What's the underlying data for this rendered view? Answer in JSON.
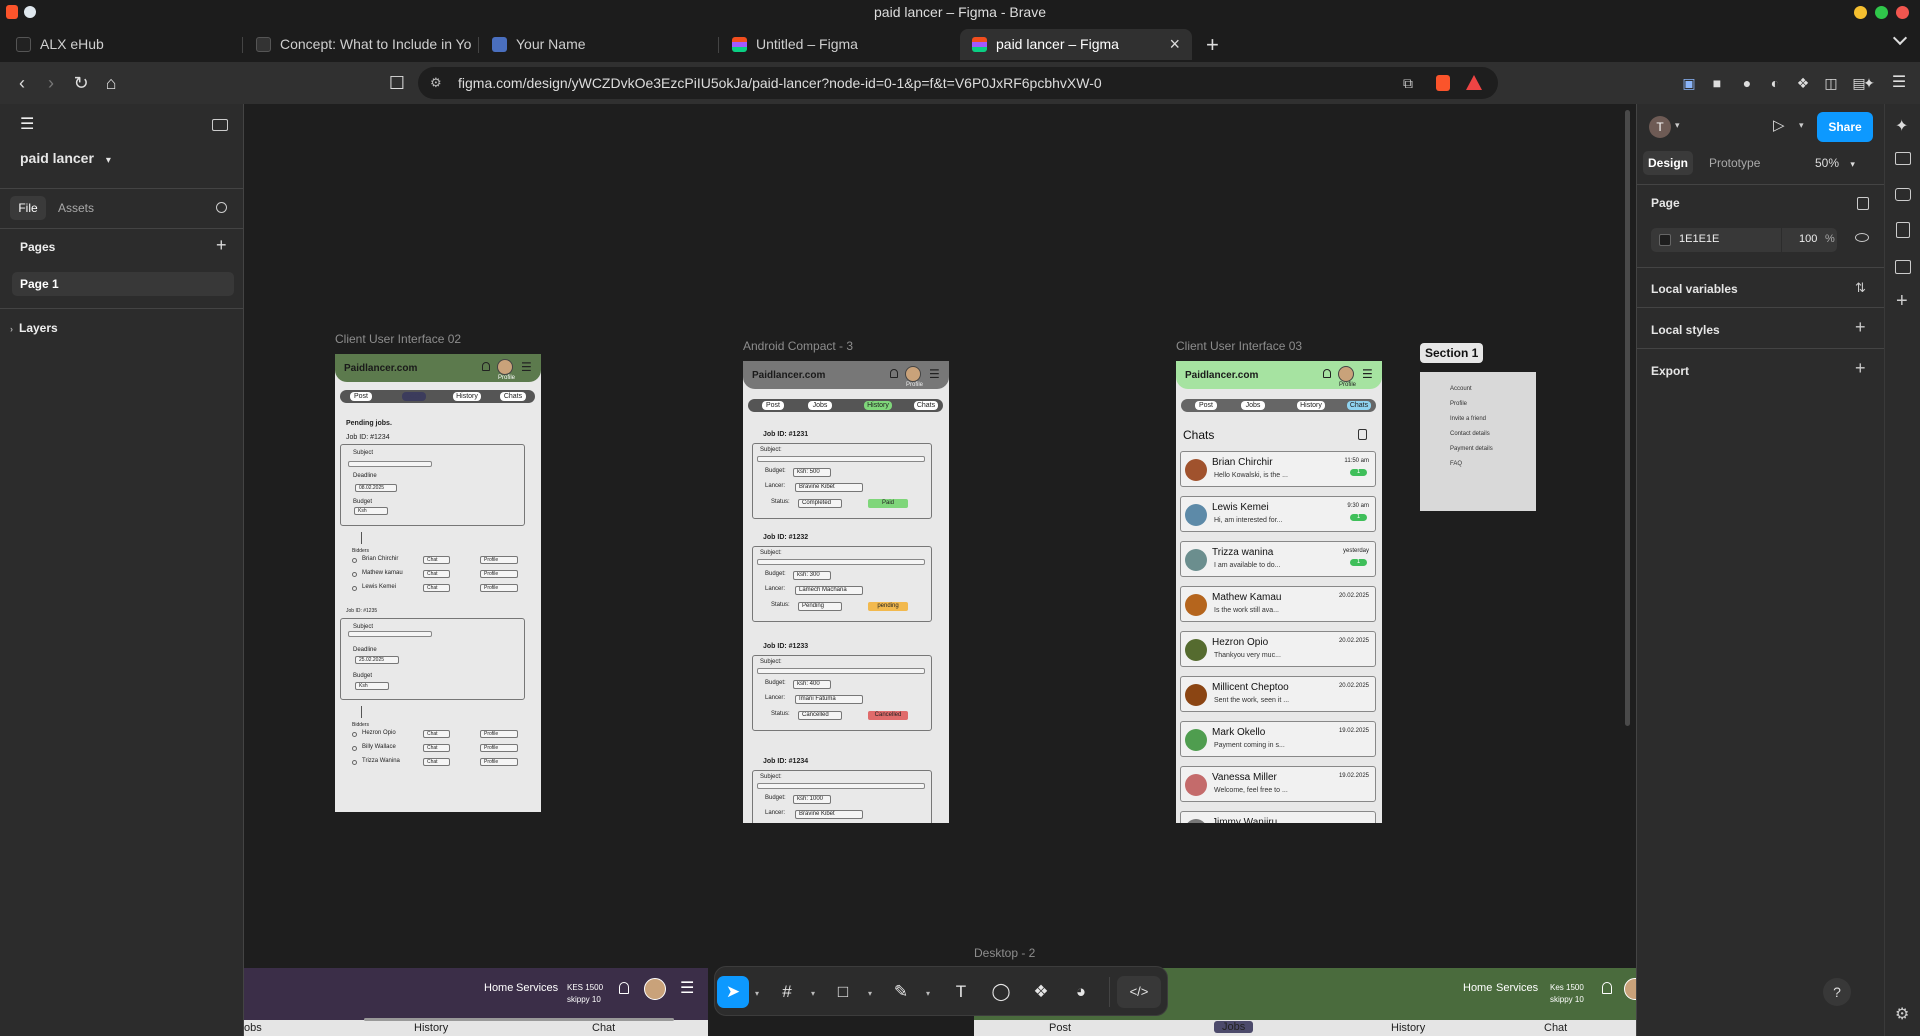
{
  "window": {
    "title": "paid lancer – Figma - Brave"
  },
  "tabs": [
    {
      "label": "ALX eHub",
      "active": false,
      "icon": "alx-icon"
    },
    {
      "label": "Concept: What to Include in Yo",
      "active": false,
      "icon": "notion-icon"
    },
    {
      "label": "Your Name",
      "active": false,
      "icon": "doc-icon"
    },
    {
      "label": "Untitled – Figma",
      "active": false,
      "icon": "figma-icon"
    },
    {
      "label": "paid lancer – Figma",
      "active": true,
      "icon": "figma-icon"
    }
  ],
  "tab_close": "×",
  "new_tab": "+",
  "address": {
    "url": "figma.com/design/yWCZDvkOe3EzcPiIU5okJa/paid-lancer?node-id=0-1&p=f&t=V6P0JxRF6pcbhvXW-0"
  },
  "left_panel": {
    "file_name": "paid lancer",
    "tab_file": "File",
    "tab_assets": "Assets",
    "pages_heading": "Pages",
    "pages": [
      "Page 1"
    ],
    "layers_heading": "Layers"
  },
  "right_panel": {
    "avatar_letter": "T",
    "share_label": "Share",
    "tab_design": "Design",
    "tab_prototype": "Prototype",
    "zoom": "50%",
    "page_heading": "Page",
    "bg_color": "1E1E1E",
    "bg_opacity": "100",
    "percent": "%",
    "local_variables": "Local variables",
    "local_styles": "Local styles",
    "export": "Export"
  },
  "canvas": {
    "frame1": {
      "label": "Client User Interface 02",
      "logo": "Paidlancer.com",
      "profile": "Profile",
      "nav": [
        "Post",
        "Jobs",
        "History",
        "Chats"
      ],
      "pending": "Pending jobs.",
      "job1": {
        "id": "Job ID: #1234",
        "subject": "Subject",
        "deadline": "Deadline",
        "deadline_value": "08.02.2025",
        "budget": "Budget",
        "budget_value": "Ksh"
      },
      "bidders_heading": "Bidders",
      "bidders1": [
        "Brian Chirchir",
        "Mathew kamau",
        "Lewis Kemei"
      ],
      "chat": "Chat",
      "profile_btn": "Profile",
      "job2": {
        "id": "Job ID: #1235",
        "subject": "Subject",
        "deadline": "Deadline",
        "deadline_value": "25.02.2025",
        "budget": "Budget",
        "budget_value": "Ksh"
      },
      "bidders2": [
        "Hezron Opio",
        "Billy Wallace",
        "Trizza Wanina"
      ]
    },
    "frame2": {
      "label": "Android Compact - 3",
      "logo": "Paidlancer.com",
      "profile": "Profile",
      "nav": [
        "Post",
        "Jobs",
        "History",
        "Chats"
      ],
      "subject_label": "Subject:",
      "budget_label": "Budget:",
      "lancer_label": "Lancer:",
      "status_label": "Status:",
      "jobs": [
        {
          "id": "Job ID: #1231",
          "budget": "ksh: 500",
          "lancer": "Bravine Kibet",
          "status": "Completed",
          "badge": "Paid",
          "badge_color": "#7fd67a"
        },
        {
          "id": "Job ID: #1232",
          "budget": "ksh: 300",
          "lancer": "Lamech Macharia",
          "status": "Pending",
          "badge": "pending",
          "badge_color": "#f2b94e"
        },
        {
          "id": "Job ID: #1233",
          "budget": "ksh: 400",
          "lancer": "Imani Fatuma",
          "status": "Cancelled",
          "badge": "Cancelled",
          "badge_color": "#e06b6b"
        },
        {
          "id": "Job ID: #1234",
          "budget": "ksh: 1000",
          "lancer": "Bravine Kibet",
          "status": "",
          "badge": "",
          "badge_color": ""
        }
      ]
    },
    "frame3": {
      "label": "Client User Interface 03",
      "logo": "Paidlancer.com",
      "profile": "Profile",
      "nav": [
        "Post",
        "Jobs",
        "History",
        "Chats"
      ],
      "chats_title": "Chats",
      "chats": [
        {
          "name": "Brian Chirchir",
          "msg": "Hello Kowalski, is the ...",
          "time": "11:50 am",
          "badge": "1",
          "color": "#a0522d"
        },
        {
          "name": "Lewis Kemei",
          "msg": "Hi, am interested for...",
          "time": "9:30 am",
          "badge": "1",
          "color": "#5d8aa8"
        },
        {
          "name": "Trizza wanina",
          "msg": "I am available to do...",
          "time": "yesterday",
          "badge": "1",
          "color": "#6b8e8e"
        },
        {
          "name": "Mathew Kamau",
          "msg": "Is the work still ava...",
          "time": "20.02.2025",
          "badge": "",
          "color": "#b5651d"
        },
        {
          "name": "Hezron Opio",
          "msg": "Thankyou very muc...",
          "time": "20.02.2025",
          "badge": "",
          "color": "#556b2f"
        },
        {
          "name": "Millicent Cheptoo",
          "msg": "Sent the work, seen it ...",
          "time": "20.02.2025",
          "badge": "",
          "color": "#8b4513"
        },
        {
          "name": "Mark Okello",
          "msg": "Payment coming in s...",
          "time": "19.02.2025",
          "badge": "",
          "color": "#4f9d4f"
        },
        {
          "name": "Vanessa Miller",
          "msg": "Welcome, feel free to ...",
          "time": "19.02.2025",
          "badge": "",
          "color": "#c46b6b"
        },
        {
          "name": "Jimmy Wanjiru",
          "msg": "",
          "time": "",
          "badge": "",
          "color": "#777"
        }
      ]
    },
    "section1": {
      "label": "Section 1",
      "items": [
        "Account",
        "Profile",
        "Invite a friend",
        "Contact details",
        "Payment details",
        "FAQ"
      ]
    },
    "desktop2": {
      "label": "Desktop - 2"
    },
    "bottom_left": {
      "nav": [
        "Home",
        "Services"
      ],
      "balance": "KES 1500",
      "user": "skippy 10",
      "tabs": [
        "obs",
        "History",
        "Chat"
      ]
    },
    "bottom_right": {
      "nav": [
        "Home",
        "Services"
      ],
      "balance": "Kes 1500",
      "user": "skippy 10",
      "tabs": [
        "Post",
        "Jobs",
        "History",
        "Chat"
      ]
    }
  },
  "help": "?"
}
